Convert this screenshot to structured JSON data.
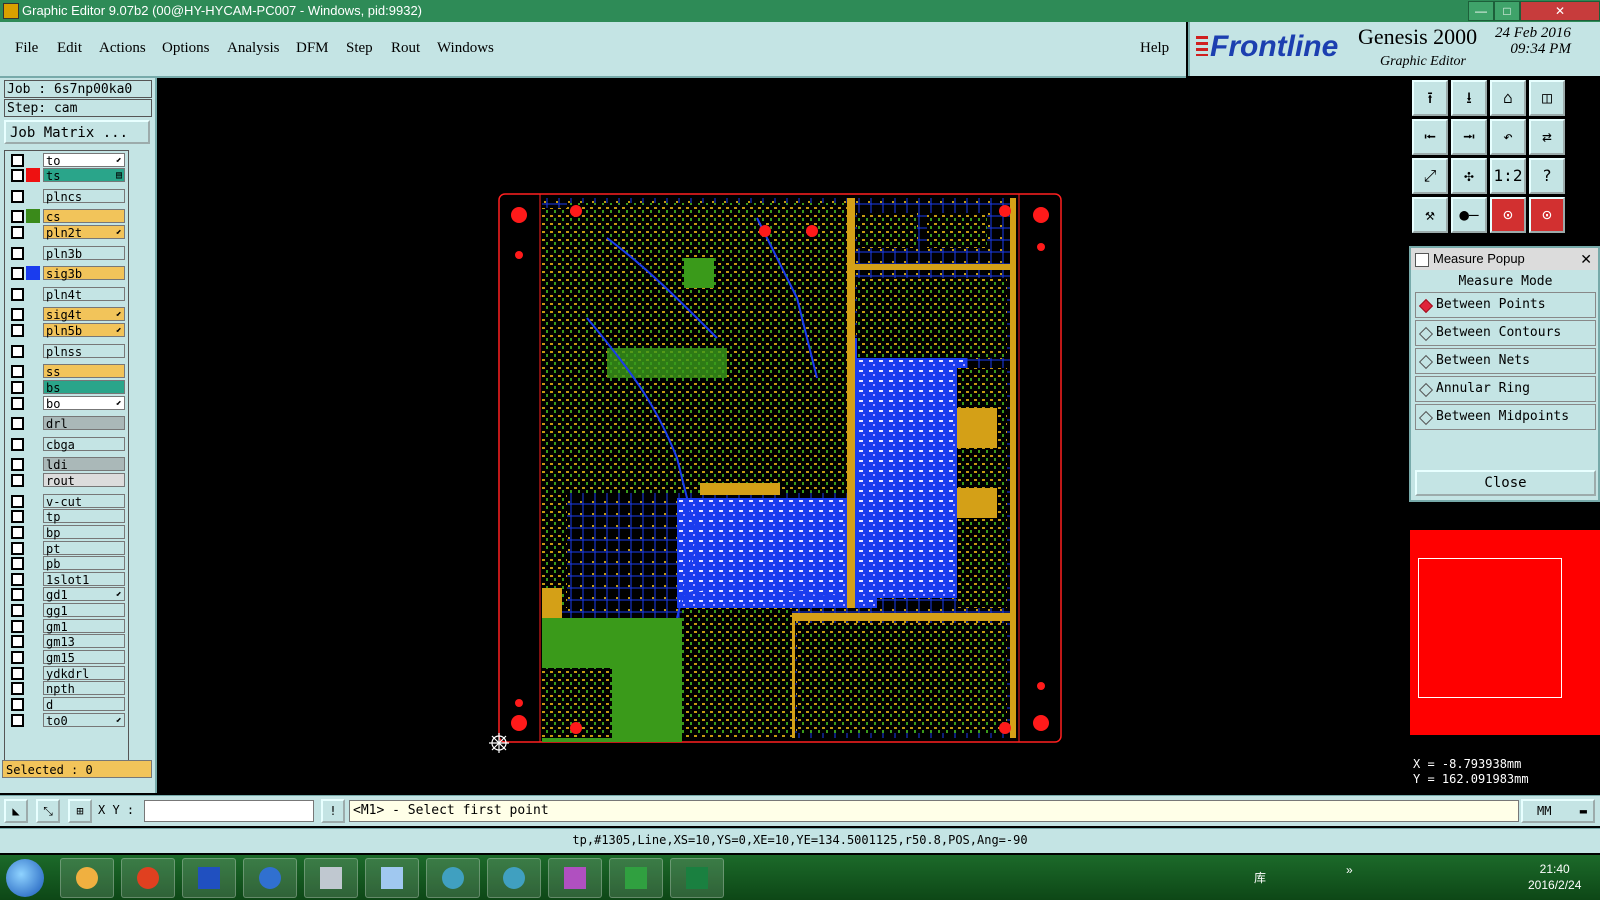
{
  "window": {
    "title": "Graphic Editor 9.07b2 (00@HY-HYCAM-PC007 - Windows, pid:9932)",
    "min": "—",
    "max": "□",
    "close": "✕"
  },
  "menu": {
    "items": [
      "File",
      "Edit",
      "Actions",
      "Options",
      "Analysis",
      "DFM",
      "Step",
      "Rout",
      "Windows"
    ],
    "help": "Help"
  },
  "brand": {
    "logo": "Frontline",
    "product": "Genesis 2000",
    "subtitle": "Graphic Editor",
    "date": "24 Feb 2016",
    "time": "09:34 PM"
  },
  "job": {
    "job_label": "Job : 6s7np00ka0",
    "step_label": "Step: cam",
    "matrix_button": "Job Matrix ..."
  },
  "layers": [
    {
      "name": "to",
      "color": "#ffffff",
      "swatch": "",
      "arrow": "⬋"
    },
    {
      "name": "ts",
      "color": "#2aa58a",
      "swatch": "#ee1111",
      "arrow": "▤"
    },
    {
      "name": "plncs",
      "color": "#c4e4e4",
      "swatch": "",
      "arrow": ""
    },
    {
      "name": "cs",
      "color": "#f2c45a",
      "swatch": "#3a8a1a",
      "arrow": ""
    },
    {
      "name": "pln2t",
      "color": "#f2c45a",
      "swatch": "",
      "arrow": "⬋"
    },
    {
      "name": "pln3b",
      "color": "#c4e4e4",
      "swatch": "",
      "arrow": ""
    },
    {
      "name": "sig3b",
      "color": "#f2c45a",
      "swatch": "#1a3cee",
      "arrow": ""
    },
    {
      "name": "pln4t",
      "color": "#c4e4e4",
      "swatch": "",
      "arrow": ""
    },
    {
      "name": "sig4t",
      "color": "#f2c45a",
      "swatch": "",
      "arrow": "⬋"
    },
    {
      "name": "pln5b",
      "color": "#f2c45a",
      "swatch": "",
      "arrow": "⬋"
    },
    {
      "name": "plnss",
      "color": "#c4e4e4",
      "swatch": "",
      "arrow": ""
    },
    {
      "name": "ss",
      "color": "#f2c45a",
      "swatch": "",
      "arrow": ""
    },
    {
      "name": "bs",
      "color": "#2aa58a",
      "swatch": "",
      "arrow": ""
    },
    {
      "name": "bo",
      "color": "#ffffff",
      "swatch": "",
      "arrow": "⬋"
    },
    {
      "name": "drl",
      "color": "#aab8b8",
      "swatch": "",
      "arrow": ""
    },
    {
      "name": "cbga",
      "color": "#c4e4e4",
      "swatch": "",
      "arrow": ""
    },
    {
      "name": "ldi",
      "color": "#aab8b8",
      "swatch": "",
      "arrow": ""
    },
    {
      "name": "rout",
      "color": "#dcdcdc",
      "swatch": "",
      "arrow": ""
    },
    {
      "name": "v-cut",
      "color": "#c4e4e4",
      "swatch": "",
      "arrow": ""
    },
    {
      "name": "tp",
      "color": "#c4e4e4",
      "swatch": "",
      "arrow": ""
    },
    {
      "name": "bp",
      "color": "#c4e4e4",
      "swatch": "",
      "arrow": ""
    },
    {
      "name": "pt",
      "color": "#c4e4e4",
      "swatch": "",
      "arrow": ""
    },
    {
      "name": "pb",
      "color": "#c4e4e4",
      "swatch": "",
      "arrow": ""
    },
    {
      "name": "1slot1",
      "color": "#c4e4e4",
      "swatch": "",
      "arrow": ""
    },
    {
      "name": "gd1",
      "color": "#c4e4e4",
      "swatch": "",
      "arrow": "⬋"
    },
    {
      "name": "gg1",
      "color": "#c4e4e4",
      "swatch": "",
      "arrow": ""
    },
    {
      "name": "gm1",
      "color": "#c4e4e4",
      "swatch": "",
      "arrow": ""
    },
    {
      "name": "gm13",
      "color": "#c4e4e4",
      "swatch": "",
      "arrow": ""
    },
    {
      "name": "gm15",
      "color": "#c4e4e4",
      "swatch": "",
      "arrow": ""
    },
    {
      "name": "ydkdrl",
      "color": "#c4e4e4",
      "swatch": "",
      "arrow": ""
    },
    {
      "name": "npth",
      "color": "#c4e4e4",
      "swatch": "",
      "arrow": ""
    },
    {
      "name": "d",
      "color": "#c4e4e4",
      "swatch": "",
      "arrow": ""
    },
    {
      "name": "to0",
      "color": "#c4e4e4",
      "swatch": "",
      "arrow": "⬋"
    }
  ],
  "selected": "Selected : 0",
  "tools": [
    "⭱",
    "⭳",
    "⌂",
    "◫",
    "⭰",
    "⭲",
    "↶",
    "⇄",
    "⤢",
    "✣",
    "1:2",
    "?",
    "⚒",
    "●—",
    "⊙",
    "⊙"
  ],
  "measure": {
    "title": "Measure Popup",
    "close_x": "✕",
    "mode_label": "Measure Mode",
    "options": [
      "Between Points",
      "Between Contours",
      "Between Nets",
      "Annular Ring",
      "Between Midpoints"
    ],
    "selected_index": 0,
    "close_button": "Close"
  },
  "coords": {
    "x": "X = -8.793938mm",
    "y": "Y = 162.091983mm"
  },
  "bottom": {
    "xy_label": "X Y :",
    "xy_value": "",
    "prompt": "<M1> - Select first point",
    "unit": "MM",
    "unit_arrow": "▬",
    "info_icon": "!",
    "tool_icons": [
      "◣",
      "⤡",
      "⊞"
    ]
  },
  "status": "tp,#1305,Line,XS=10,YS=0,XE=10,YE=134.5001125,r50.8,POS,Ang=-90",
  "tray": {
    "lang": "库",
    "time": "21:40",
    "date": "2016/2/24",
    "chevron": "»"
  },
  "colors": {
    "accent_bg": "#c4e4e4",
    "titlebar": "#2e8b57",
    "pcb_outline": "#ff0000",
    "trace_gold": "#d4a017",
    "trace_green": "#3a9a1a",
    "trace_blue": "#1a3cee"
  }
}
